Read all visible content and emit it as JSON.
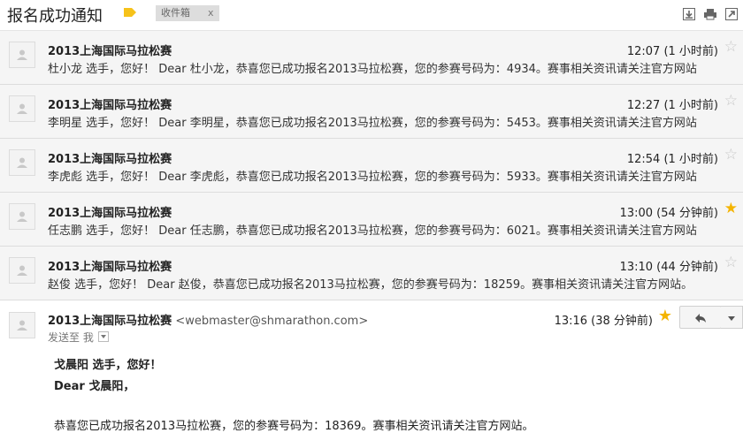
{
  "header": {
    "subject": "报名成功通知",
    "chip_label": "收件箱",
    "chip_close": "x",
    "icons": [
      "download-icon",
      "print-icon",
      "new-window-icon"
    ]
  },
  "messages": [
    {
      "sender": "2013上海国际马拉松赛",
      "time": "12:07 (1 小时前)",
      "starred": false,
      "snippet": "杜小龙 选手，您好！ Dear 杜小龙，恭喜您已成功报名2013马拉松赛，您的参赛号码为：4934。赛事相关资讯请关注官方网站"
    },
    {
      "sender": "2013上海国际马拉松赛",
      "time": "12:27 (1 小时前)",
      "starred": false,
      "snippet": "李明星 选手，您好！ Dear 李明星，恭喜您已成功报名2013马拉松赛，您的参赛号码为：5453。赛事相关资讯请关注官方网站"
    },
    {
      "sender": "2013上海国际马拉松赛",
      "time": "12:54 (1 小时前)",
      "starred": false,
      "snippet": "李虎彪 选手，您好！ Dear 李虎彪，恭喜您已成功报名2013马拉松赛，您的参赛号码为：5933。赛事相关资讯请关注官方网站"
    },
    {
      "sender": "2013上海国际马拉松赛",
      "time": "13:00 (54 分钟前)",
      "starred": true,
      "snippet": "任志鹏 选手，您好！ Dear 任志鹏，恭喜您已成功报名2013马拉松赛，您的参赛号码为：6021。赛事相关资讯请关注官方网站"
    },
    {
      "sender": "2013上海国际马拉松赛",
      "time": "13:10 (44 分钟前)",
      "starred": false,
      "snippet": "赵俊 选手，您好！ Dear 赵俊，恭喜您已成功报名2013马拉松赛，您的参赛号码为：18259。赛事相关资讯请关注官方网站。"
    }
  ],
  "open_message": {
    "sender": "2013上海国际马拉松赛",
    "email": "<webmaster@shmarathon.com>",
    "send_to": "发送至 我",
    "time": "13:16 (38 分钟前)",
    "greeting": "戈晨阳 选手，您好！",
    "dear": "Dear 戈晨阳，",
    "body": "恭喜您已成功报名2013马拉松赛，您的参赛号码为：18369。赛事相关资讯请关注官方网站。"
  },
  "colors": {
    "star_on": "#f4b400",
    "star_off": "#c7c7c7",
    "label_tag": "#f6c21a"
  }
}
